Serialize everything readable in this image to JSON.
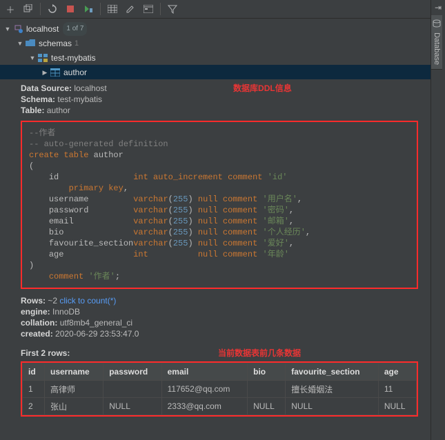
{
  "toolbar": {
    "buttons": [
      "add",
      "copy",
      "refresh",
      "stop",
      "run",
      "spacer",
      "table",
      "edit",
      "form",
      "spacer",
      "filter"
    ]
  },
  "right_tab": "Database",
  "tree": {
    "root": {
      "label": "localhost",
      "extra": "1 of 7"
    },
    "schemas_label": "schemas",
    "schemas_count": "1",
    "db": "test-mybatis",
    "table": "author"
  },
  "meta": {
    "data_source_label": "Data Source:",
    "data_source": "localhost",
    "schema_label": "Schema:",
    "schema": "test-mybatis",
    "table_label": "Table:",
    "table": "author"
  },
  "annotation1": "数据库DDL信息",
  "ddl": {
    "comment1": "--作者",
    "comment2": "-- auto-generated definition",
    "kw_create": "create table",
    "tbl_name": "author",
    "pk_line": "primary key",
    "table_comment_kw": "comment",
    "table_comment_val": "'作者'",
    "cols": [
      {
        "name": "id",
        "type": "int",
        "type_arg": "",
        "nullable": "",
        "comment_kw": "auto_increment comment",
        "comment_val": "'id'"
      },
      {
        "name": "username",
        "type": "varchar",
        "type_arg": "255",
        "nullable": "null",
        "comment_kw": "comment",
        "comment_val": "'用户名'"
      },
      {
        "name": "password",
        "type": "varchar",
        "type_arg": "255",
        "nullable": "null",
        "comment_kw": "comment",
        "comment_val": "'密码'"
      },
      {
        "name": "email",
        "type": "varchar",
        "type_arg": "255",
        "nullable": "null",
        "comment_kw": "comment",
        "comment_val": "'邮箱'"
      },
      {
        "name": "bio",
        "type": "varchar",
        "type_arg": "255",
        "nullable": "null",
        "comment_kw": "comment",
        "comment_val": "'个人经历'"
      },
      {
        "name": "favourite_section",
        "type": "varchar",
        "type_arg": "255",
        "nullable": "null",
        "comment_kw": "comment",
        "comment_val": "'爱好'"
      },
      {
        "name": "age",
        "type": "int",
        "type_arg": "",
        "nullable": "null",
        "comment_kw": "comment",
        "comment_val": "'年龄'"
      }
    ]
  },
  "stats": {
    "rows_label": "Rows:",
    "rows_val": "~2",
    "count_link": "click to count(*)",
    "engine_label": "engine:",
    "engine": "InnoDB",
    "collation_label": "collation:",
    "collation": "utf8mb4_general_ci",
    "created_label": "created:",
    "created": "2020-06-29 23:53:47.0"
  },
  "annotation2": "当前数据表前几条数据",
  "preview": {
    "title": "First 2 rows:",
    "headers": [
      "id",
      "username",
      "password",
      "email",
      "bio",
      "favourite_section",
      "age"
    ],
    "rows": [
      {
        "id": "1",
        "username": "高律师",
        "password": "",
        "email": "117652@qq.com",
        "bio": "",
        "favourite_section": "擅长婚姻法",
        "age": "11"
      },
      {
        "id": "2",
        "username": "张山",
        "password": "NULL",
        "email": "2333@qq.com",
        "bio": "NULL",
        "favourite_section": "NULL",
        "age": "NULL"
      }
    ]
  }
}
